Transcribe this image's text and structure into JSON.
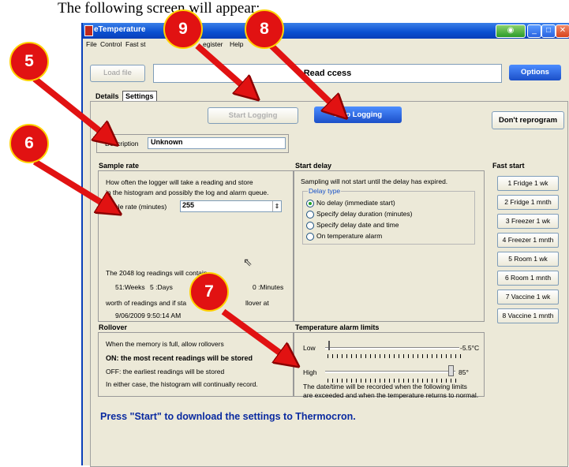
{
  "caption": "The following screen will appear:",
  "window": {
    "title": "eTemperature",
    "menu": [
      "File",
      "Control",
      "Fast st",
      "egister",
      "Help"
    ]
  },
  "toolbar": {
    "load_file": "Load file",
    "status": "Read ccess",
    "options": "Options"
  },
  "tabs": [
    "Details",
    "Settings"
  ],
  "logging": {
    "start": "Start Logging",
    "stop": "Stop Logging",
    "dont_reprogram": "Don't reprogram"
  },
  "description": {
    "label": "Description",
    "value": "Unknown"
  },
  "sample_rate": {
    "header": "Sample rate",
    "line1": "How often the logger will take a reading and store",
    "line2": "in the histogram and possibly the log and alarm queue.",
    "rate_label": "mple rate (minutes)",
    "rate_value": "255",
    "contain": "The 2048 log readings will contain",
    "weeks": "51:Weeks",
    "days": "5 :Days",
    "minutes": "0 :Minutes",
    "worth": "worth of readings and if sta",
    "rollover_at": "llover at",
    "date": "9/06/2009 9:50:14 AM"
  },
  "start_delay": {
    "header": "Start delay",
    "note": "Sampling will not start until the delay has expired.",
    "group": "Delay type",
    "options": [
      "No delay (immediate start)",
      "Specify delay duration (minutes)",
      "Specify delay date and time",
      "On temperature alarm"
    ],
    "selected": 0
  },
  "fast_start": {
    "header": "Fast start",
    "buttons": [
      "1 Fridge 1 wk",
      "2 Fridge 1 mnth",
      "3 Freezer 1 wk",
      "4 Freezer 1 mnth",
      "5 Room 1 wk",
      "6 Room 1 mnth",
      "7 Vaccine 1 wk",
      "8 Vaccine 1 mnth"
    ]
  },
  "rollover": {
    "header": "Rollover",
    "line1": "When the memory is full, allow rollovers",
    "on": "ON: the most recent readings will be stored",
    "off": "OFF: the earliest readings will be stored",
    "either": "In either case, the histogram will continually record."
  },
  "alarm": {
    "header": "Temperature alarm limits",
    "low_label": "Low",
    "low_value": "-5.5°C",
    "high_label": "High",
    "high_value": "85°",
    "note1": "The date/time will be recorded when the following limits",
    "note2": "are exceeded and when the temperature returns to normal."
  },
  "footer": "Press \"Start\" to download the settings to Thermocron.",
  "callouts": [
    "5",
    "6",
    "7",
    "8",
    "9"
  ],
  "colors": {
    "callout": "#e11212",
    "callout_border": "#ffd200",
    "arrow": "#e11212",
    "footer_text": "#0a2aa0"
  }
}
